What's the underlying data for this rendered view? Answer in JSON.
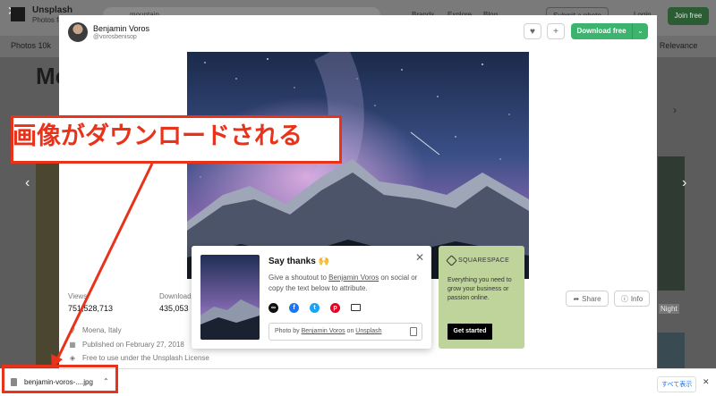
{
  "background": {
    "brand": "Unsplash",
    "brand_sub": "Photos fo",
    "search_value": "mountain",
    "nav": [
      "Brands",
      "Explore",
      "Blog"
    ],
    "submit_label": "Submit a photo",
    "login_label": "Login",
    "join_label": "Join free",
    "photos_tab": "Photos 10k",
    "sort_label": "y, Relevance",
    "big_title": "Mo",
    "night_label": "Night"
  },
  "modal": {
    "author_name": "Benjamin Voros",
    "author_handle": "@vorosbenisop",
    "download_label": "Download free",
    "stats": {
      "views_label": "Views",
      "views_value": "751,528,713",
      "downloads_label": "Download",
      "downloads_value": "435,053"
    },
    "location": "Moena, Italy",
    "published": "Published on February 27, 2018",
    "license": "Free to use under the Unsplash License",
    "share_label": "Share",
    "info_label": "Info"
  },
  "thanks": {
    "title": "Say thanks 🙌",
    "desc_before": "Give a shoutout to ",
    "desc_link": "Benjamin Voros",
    "desc_after": " on social or copy the text below to attribute.",
    "credit_prefix": "Photo by ",
    "credit_author": "Benjamin Voros",
    "credit_mid": " on ",
    "credit_site": "Unsplash",
    "socials": [
      {
        "icon": "link-icon",
        "color": "#111111"
      },
      {
        "icon": "facebook-icon",
        "color": "#1877f2"
      },
      {
        "icon": "twitter-icon",
        "color": "#1da1f2"
      },
      {
        "icon": "pinterest-icon",
        "color": "#e60023"
      },
      {
        "icon": "email-icon",
        "color": "#333333"
      }
    ]
  },
  "ad": {
    "brand": "SQUARESPACE",
    "text": "Everything you need to grow your business or passion online.",
    "button": "Get started",
    "bg_color": "#bed49b"
  },
  "annotation": {
    "text": "画像がダウンロードされる",
    "color": "#e8321a"
  },
  "download_bar": {
    "filename": "benjamin-voros-....jpg",
    "show_all": "すべて表示"
  }
}
